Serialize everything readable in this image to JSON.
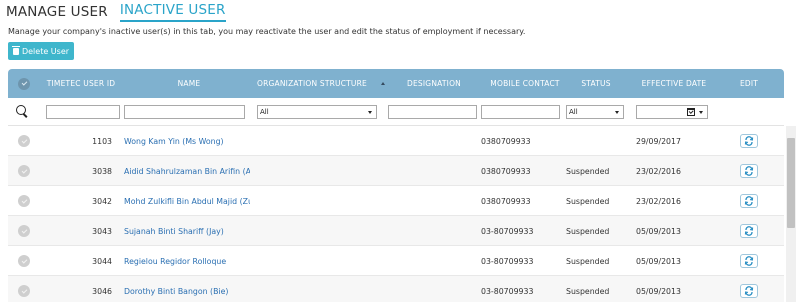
{
  "tabs": [
    {
      "label": "MANAGE USER",
      "active": false
    },
    {
      "label": "INACTIVE USER",
      "active": true
    }
  ],
  "description": "Manage your company's inactive user(s) in this tab, you may reactivate the user and edit the status of employment if necessary.",
  "toolbar": {
    "delete_label": "Delete User"
  },
  "columns": {
    "timetec_user_id": "TIMETEC USER ID",
    "name": "NAME",
    "organization_structure": "ORGANIZATION STRUCTURE",
    "designation": "DESIGNATION",
    "mobile_contact": "MOBILE CONTACT",
    "status": "STATUS",
    "effective_date": "EFFECTIVE DATE",
    "edit": "EDIT"
  },
  "filters": {
    "organization_structure": "All",
    "status": "All"
  },
  "rows": [
    {
      "id": "1103",
      "name": "Wong Kam Yin (Ms Wong)",
      "mobile": "0380709933",
      "status": "",
      "date": "29/09/2017"
    },
    {
      "id": "3038",
      "name": "Aidid Shahrulzaman Bin Arifin (Aidid",
      "mobile": "0380709933",
      "status": "Suspended",
      "date": "23/02/2016"
    },
    {
      "id": "3042",
      "name": "Mohd Zulkifli Bin Abdul Majid (Zul)",
      "mobile": "0380709933",
      "status": "Suspended",
      "date": "23/02/2016"
    },
    {
      "id": "3043",
      "name": "Sujanah Binti Shariff (Jay)",
      "mobile": "03-80709933",
      "status": "Suspended",
      "date": "05/09/2013"
    },
    {
      "id": "3044",
      "name": "Regielou Regidor Rolloque",
      "mobile": "03-80709933",
      "status": "Suspended",
      "date": "05/09/2013"
    },
    {
      "id": "3046",
      "name": "Dorothy Binti Bangon (Bie)",
      "mobile": "03-80709933",
      "status": "Suspended",
      "date": "05/09/2013"
    }
  ],
  "colors": {
    "accent": "#2aa4c9",
    "header": "#7fb1cf",
    "button": "#3fb6cc",
    "link": "#2a6fb2"
  }
}
